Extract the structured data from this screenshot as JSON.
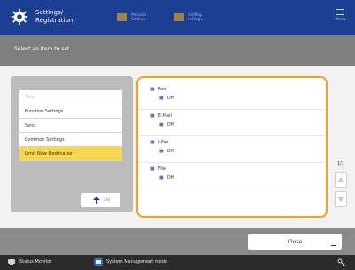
{
  "header": {
    "title_line1": "Settings/",
    "title_line2": "Registration",
    "btn_left_label_line1": "Personal",
    "btn_left_label_line2": "Settings",
    "btn_right_label_line1": "Set/Reg.",
    "btn_right_label_line2": "Settings",
    "menu_label": "Menu"
  },
  "instruction": "Select an item to set.",
  "left_list": {
    "items": [
      {
        "label": "Title"
      },
      {
        "label": "Function Settings"
      },
      {
        "label": "Send"
      },
      {
        "label": "Common Settings"
      },
      {
        "label": "Limit New Destination"
      }
    ],
    "up_label": "Up"
  },
  "right_settings": {
    "groups": [
      {
        "title": "Fax",
        "value": "Off"
      },
      {
        "title": "E-Mail",
        "value": "Off"
      },
      {
        "title": "I-Fax",
        "value": "Off"
      },
      {
        "title": "File",
        "value": "Off"
      }
    ]
  },
  "pager": {
    "page": "1/1"
  },
  "close_label": "Close",
  "status_bar": {
    "status_monitor": "Status Monitor",
    "system_mode": "System Management mode"
  },
  "colors": {
    "header_bg": "#1d3f93",
    "selected_item": "#f6d84a",
    "right_panel_border": "#f0a21e"
  },
  "icons": {
    "header_gear": "gear-icon",
    "up_arrow": "arrow-up-icon",
    "close_corner": "corner-icon",
    "status_monitor": "status-monitor-icon",
    "system_mode": "system-mode-icon",
    "key_icon": "key-icon"
  }
}
